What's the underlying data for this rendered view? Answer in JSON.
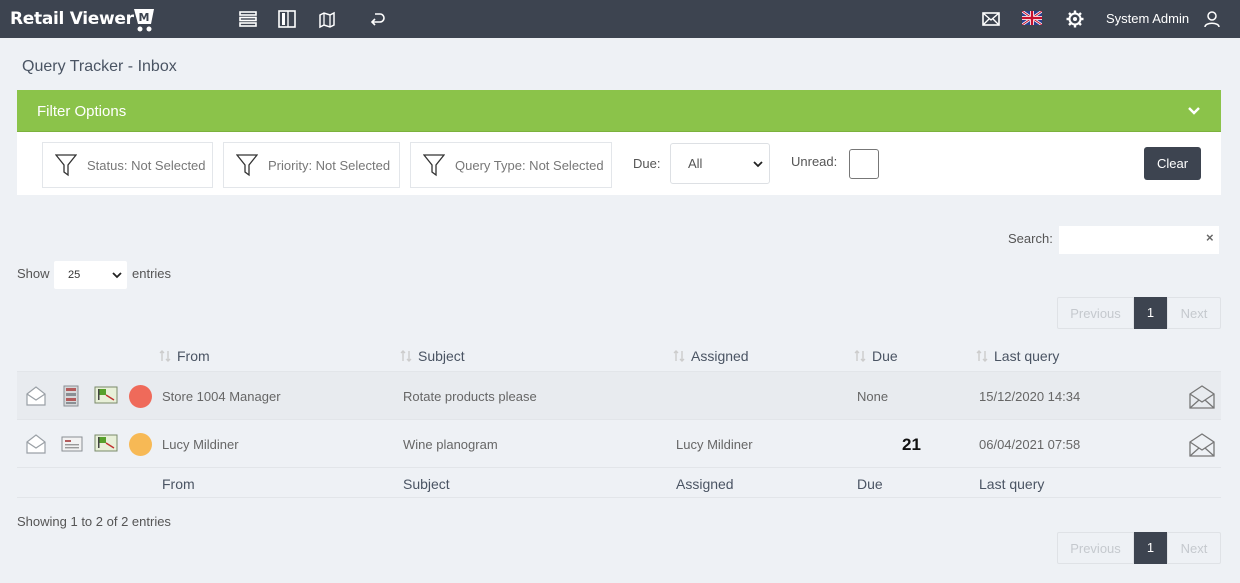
{
  "app": {
    "brand": "Retail Viewer",
    "brand_mark": "M",
    "user": "System Admin"
  },
  "page": {
    "title": "Query Tracker - Inbox"
  },
  "filters": {
    "header": "Filter Options",
    "status": "Status: Not Selected",
    "priority": "Priority: Not Selected",
    "query_type": "Query Type: Not Selected",
    "due_label": "Due:",
    "due_value": "All",
    "unread_label": "Unread:",
    "unread_checked": false,
    "clear_label": "Clear"
  },
  "table_controls": {
    "search_label": "Search:",
    "search_value": "",
    "search_clear": "×",
    "show_label": "Show",
    "entries_value": "25",
    "entries_label": "entries"
  },
  "pagination": {
    "previous": "Previous",
    "current": "1",
    "next": "Next"
  },
  "columns": {
    "from": "From",
    "subject": "Subject",
    "assigned": "Assigned",
    "due": "Due",
    "last_query": "Last query"
  },
  "rows": [
    {
      "from": "Store 1004 Manager",
      "subject": "Rotate products please",
      "assigned": "",
      "due": "None",
      "last_query": "15/12/2020 14:34",
      "priority_color": "#ef6a5a"
    },
    {
      "from": "Lucy Mildiner",
      "subject": "Wine planogram",
      "assigned": "Lucy Mildiner",
      "due": "21",
      "last_query": "06/04/2021 07:58",
      "priority_color": "#f7b955"
    }
  ],
  "footer": {
    "showing": "Showing 1 to 2 of 2 entries"
  }
}
